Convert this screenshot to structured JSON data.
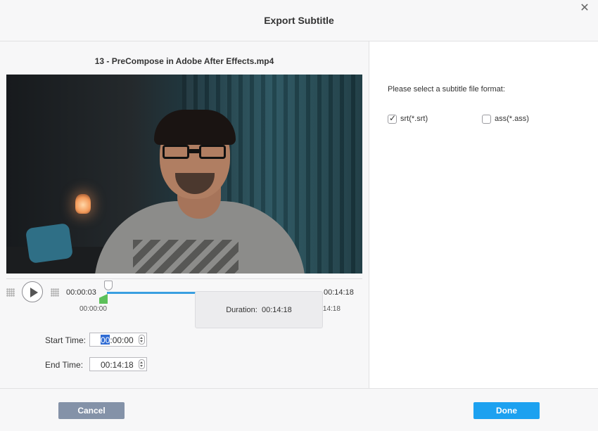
{
  "dialog": {
    "title": "Export Subtitle",
    "close_icon": "close-icon"
  },
  "player": {
    "filename": "13 - PreCompose in Adobe After Effects.mp4",
    "current_time": "00:00:03",
    "total_time": "00:14:18",
    "range_start_label": "00:00:00",
    "range_end_label": "00:14:18",
    "play_icon": "play-icon",
    "progress_color": "#3a9fe0",
    "marker_color": "#5cc05a"
  },
  "trim": {
    "start_label": "Start Time:",
    "start_value_highlight": "00",
    "start_value_rest": ":00:00",
    "end_label": "End Time:",
    "end_value": "00:14:18",
    "duration_label": "Duration:",
    "duration_value": "00:14:18"
  },
  "format": {
    "prompt": "Please select a subtitle file format:",
    "options": [
      {
        "label": "srt(*.srt)",
        "checked": true
      },
      {
        "label": "ass(*.ass)",
        "checked": false
      }
    ]
  },
  "footer": {
    "cancel_label": "Cancel",
    "done_label": "Done",
    "cancel_color": "#8492a8",
    "done_color": "#1ca1f0"
  }
}
